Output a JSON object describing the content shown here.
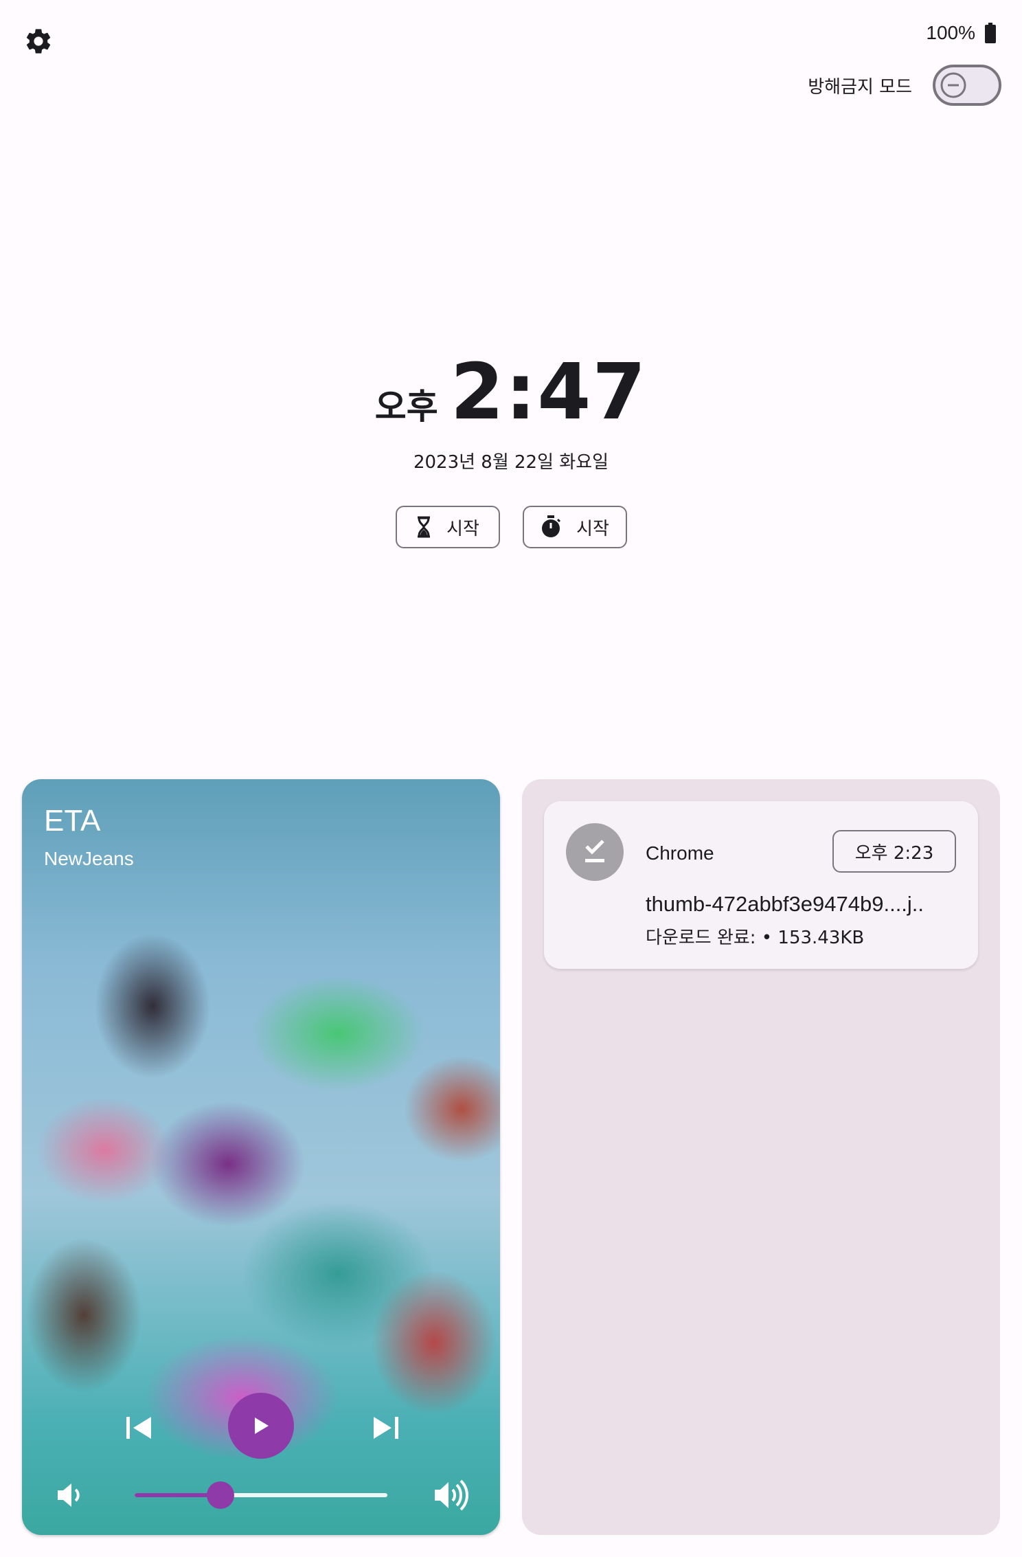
{
  "status_bar": {
    "battery": "100%"
  },
  "dnd": {
    "label": "방해금지 모드"
  },
  "clock": {
    "ampm": "오후",
    "time": "2:47",
    "date": "2023년 8월 22일 화요일"
  },
  "chips": {
    "timer_label": "시작",
    "stopwatch_label": "시작"
  },
  "media": {
    "title": "ETA",
    "artist": "NewJeans",
    "volume_level": 0.34,
    "accent": "#8e3aa8"
  },
  "notification": {
    "app": "Chrome",
    "time": "오후 2:23",
    "file": "thumb-472abbf3e9474b9....j..",
    "status": "다운로드 완료: • 153.43KB"
  },
  "icons": [
    "gear-icon",
    "battery-icon",
    "dnd-icon",
    "hourglass-icon",
    "stopwatch-icon",
    "skip-previous-icon",
    "play-icon",
    "skip-next-icon",
    "volume-low-icon",
    "volume-high-icon",
    "download-done-icon"
  ]
}
